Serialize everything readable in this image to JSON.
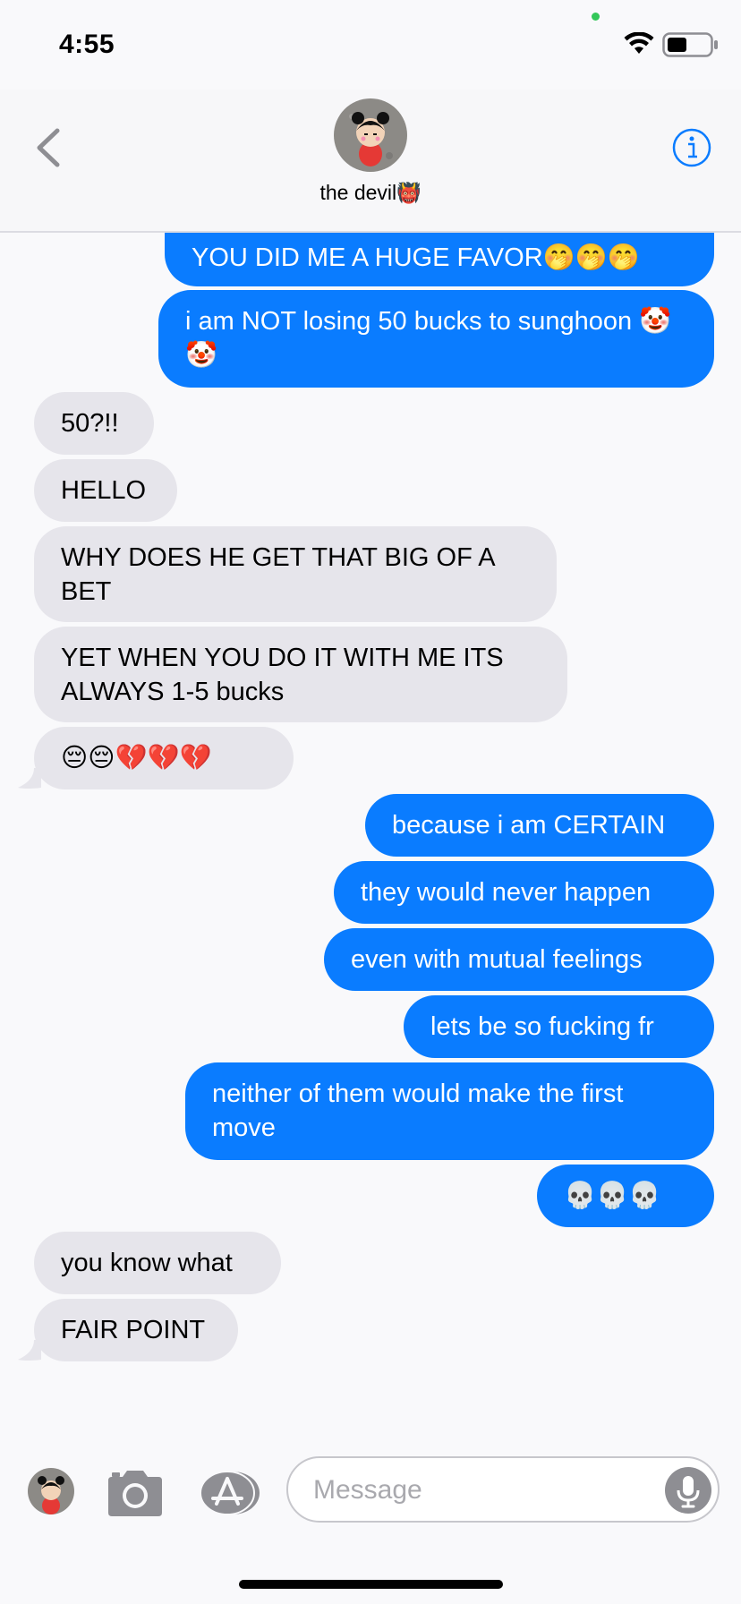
{
  "status_bar": {
    "time": "4:55",
    "icons": [
      "wifi-icon",
      "battery-icon"
    ]
  },
  "header": {
    "contact_name": "the devil",
    "contact_emoji": "👹",
    "back_icon": "chevron-left-icon",
    "info_icon": "info-icon"
  },
  "messages": [
    {
      "side": "sent",
      "text": "YOU DID ME A HUGE FAVOR🤭🤭🤭"
    },
    {
      "side": "sent",
      "text": "i am NOT losing 50 bucks to sunghoon 🤡🤡"
    },
    {
      "side": "received",
      "text": "50?!!"
    },
    {
      "side": "received",
      "text": "HELLO"
    },
    {
      "side": "received",
      "text": "WHY DOES HE GET THAT BIG OF A BET"
    },
    {
      "side": "received",
      "text": "YET WHEN YOU DO IT WITH ME ITS ALWAYS 1-5 bucks"
    },
    {
      "side": "received",
      "text": "😔😔💔💔💔"
    },
    {
      "side": "sent",
      "text": "because i am CERTAIN"
    },
    {
      "side": "sent",
      "text": "they would never happen"
    },
    {
      "side": "sent",
      "text": "even with mutual feelings"
    },
    {
      "side": "sent",
      "text": "lets be so fucking fr"
    },
    {
      "side": "sent",
      "text": "neither of them would make the first move"
    },
    {
      "side": "sent",
      "text": "💀💀💀"
    },
    {
      "side": "received",
      "text": "you know what"
    },
    {
      "side": "received",
      "text": "FAIR POINT"
    }
  ],
  "input_bar": {
    "placeholder": "Message",
    "icons": [
      "camera-icon",
      "app-store-icon",
      "microphone-icon"
    ]
  },
  "colors": {
    "sent_bubble": "#0a7cff",
    "received_bubble": "#e6e5eb",
    "accent": "#0a7cff"
  }
}
